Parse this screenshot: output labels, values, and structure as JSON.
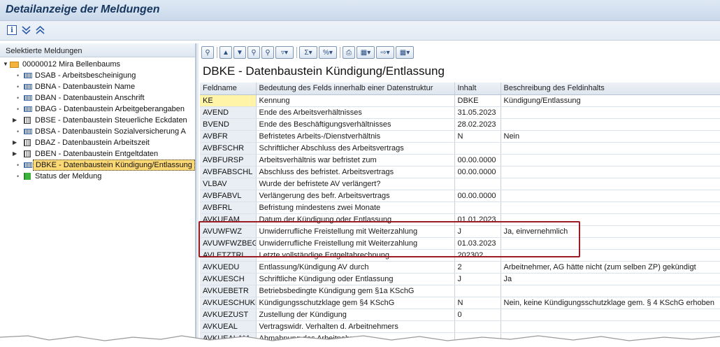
{
  "window": {
    "title": "Detailanzeige der Meldungen"
  },
  "toolbar": {
    "icons": [
      "info-icon",
      "expand-all-icon",
      "collapse-all-icon"
    ]
  },
  "left": {
    "header": "Selektierte Meldungen",
    "root": "00000012 Mira Bellenbaums",
    "items": [
      {
        "label": "DSAB - Arbeitsbescheinigung",
        "icon": "barcode",
        "expandable": false
      },
      {
        "label": "DBNA - Datenbaustein Name",
        "icon": "barcode",
        "expandable": false
      },
      {
        "label": "DBAN - Datenbaustein Anschrift",
        "icon": "barcode",
        "expandable": false
      },
      {
        "label": "DBAG - Datenbaustein Arbeitgeberangaben",
        "icon": "barcode",
        "expandable": false
      },
      {
        "label": "DBSE - Datenbaustein Steuerliche Eckdaten",
        "icon": "table",
        "expandable": true
      },
      {
        "label": "DBSA - Datenbaustein Sozialversicherung A",
        "icon": "barcode",
        "expandable": false
      },
      {
        "label": "DBAZ - Datenbaustein Arbeitszeit",
        "icon": "table",
        "expandable": true
      },
      {
        "label": "DBEN - Datenbaustein Entgeltdaten",
        "icon": "table",
        "expandable": true
      },
      {
        "label": "DBKE - Datenbaustein Kündigung/Entlassung",
        "icon": "barcode",
        "expandable": false,
        "selected": true
      },
      {
        "label": "Status der Meldung",
        "icon": "flag",
        "expandable": false
      }
    ]
  },
  "right": {
    "title": "DBKE - Datenbaustein Kündigung/Entlassung",
    "columns": [
      "Feldname",
      "Bedeutung des Felds innerhalb einer Datenstruktur",
      "Inhalt",
      "Beschreibung des Feldinhalts"
    ],
    "rows": [
      [
        "KE",
        "Kennung",
        "DBKE",
        "Kündigung/Entlassung"
      ],
      [
        "AVEND",
        "Ende des Arbeitsverhältnisses",
        "31.05.2023",
        ""
      ],
      [
        "BVEND",
        "Ende des Beschäftigungsverhältnisses",
        "28.02.2023",
        ""
      ],
      [
        "AVBFR",
        "Befristetes Arbeits-/Dienstverhältnis",
        "N",
        "Nein"
      ],
      [
        "AVBFSCHR",
        "Schriftlicher Abschluss des Arbeitsvertrags",
        "",
        ""
      ],
      [
        "AVBFURSP",
        "Arbeitsverhältnis war befristet zum",
        "00.00.0000",
        ""
      ],
      [
        "AVBFABSCHL",
        "Abschluss des befristet. Arbeitsvertrags",
        "00.00.0000",
        ""
      ],
      [
        "VLBAV",
        "Wurde der befristete AV verlängert?",
        "",
        ""
      ],
      [
        "AVBFABVL",
        "Verlängerung des befr. Arbeitsvertrags",
        "00.00.0000",
        ""
      ],
      [
        "AVBFRL",
        "Befristung mindestens zwei Monate",
        "",
        ""
      ],
      [
        "AVKUEAM",
        "Datum der Kündigung oder Entlassung",
        "01.01.2023",
        ""
      ],
      [
        "AVUWFWZ",
        "Unwiderrufliche Freistellung mit Weiterzahlung",
        "J",
        "Ja, einvernehmlich"
      ],
      [
        "AVUWFWZBEG",
        "Unwiderrufliche Freistellung mit Weiterzahlung",
        "01.03.2023",
        ""
      ],
      [
        "AVLETZTRL",
        "Letzte vollständige Entgeltabrechnung",
        "202302",
        ""
      ],
      [
        "AVKUEDU",
        "Entlassung/Kündigung AV durch",
        "2",
        "Arbeitnehmer, AG hätte nicht (zum selben ZP) gekündigt"
      ],
      [
        "AVKUESCH",
        "Schriftliche Kündigung oder Entlassung",
        "J",
        "Ja"
      ],
      [
        "AVKUEBETR",
        "Betriebsbedingte Kündigung gem §1a KSchG",
        "",
        ""
      ],
      [
        "AVKUESCHUKL",
        "Kündigungsschutzklage gem §4 KSchG",
        "N",
        "Nein, keine Kündigungsschutzklage gem. § 4 KSchG erhoben"
      ],
      [
        "AVKUEZUST",
        "Zustellung der Kündigung",
        "0",
        ""
      ],
      [
        "AVKUEAL",
        "Vertragswidr. Verhalten d. Arbeitnehmers",
        "",
        ""
      ],
      [
        "AVKUEALAM",
        "Abmahnung des Arbeitnehmers",
        "",
        ""
      ]
    ]
  },
  "colors": {
    "highlight_border": "#9b1c22",
    "key_row": "#fff4a8",
    "selected_node": "#fdd975"
  }
}
